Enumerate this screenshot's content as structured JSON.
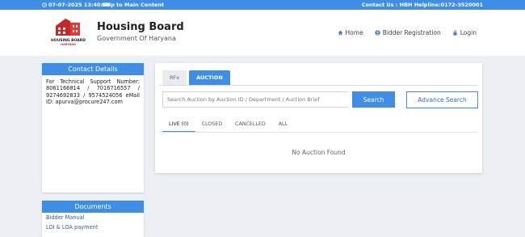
{
  "topbar": {
    "datetime": "07-07-2025 13:40:49",
    "skip_link": "Skip to Main Content",
    "contact": "Contact Us : HBH Helpline:0172-3520001"
  },
  "header": {
    "logo_line1": "HOUSING BOARD",
    "logo_line2": "HARYANA",
    "title": "Housing Board",
    "subtitle": "Government Of Haryana"
  },
  "nav": {
    "home": "Home",
    "bidder_registration": "Bidder Registration",
    "login": "Login"
  },
  "contact_details": {
    "heading": "Contact Details",
    "body": "For Technical Support Number: 8061166814 / 7016716557 / 9274692833 / 9574524056 eMail ID: apurva@procure247.com"
  },
  "documents": {
    "heading": "Documents",
    "items": [
      "Bidder Manual",
      "LOI & LOA payment"
    ]
  },
  "main": {
    "tabs": [
      "RFx",
      "AUCTION"
    ],
    "search_placeholder": "Search Auction by Auction ID / Department / Auction Brief",
    "search_button": "Search",
    "advance_search_button": "Advance Search",
    "filters": [
      "LIVE (0)",
      "CLOSED",
      "CANCELLED",
      "ALL"
    ],
    "empty_message": "No Auction Found"
  },
  "colors": {
    "accent": "#3f8ee6",
    "link": "#2d5fa6"
  }
}
